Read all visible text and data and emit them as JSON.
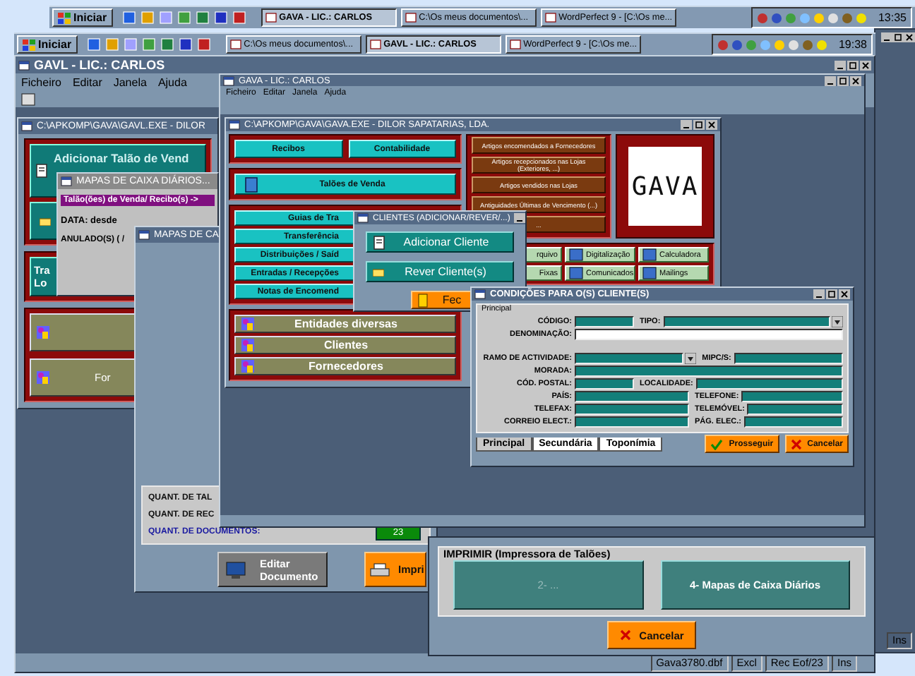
{
  "taskbars": [
    {
      "start": "Iniciar",
      "tasks": [
        {
          "label": "GAVA - LIC.: CARLOS",
          "selected": true
        },
        {
          "label": "C:\\Os meus documentos\\...",
          "selected": false
        },
        {
          "label": "WordPerfect 9 - [C:\\Os me...",
          "selected": false
        }
      ],
      "clock": "13:35"
    },
    {
      "start": "Iniciar",
      "tasks": [
        {
          "label": "C:\\Os meus documentos\\...",
          "selected": false
        },
        {
          "label": "GAVL - LIC.: CARLOS",
          "selected": true
        },
        {
          "label": "WordPerfect 9 - [C:\\Os me...",
          "selected": false
        }
      ],
      "clock": "19:38"
    }
  ],
  "back_window": {
    "status": "Ins"
  },
  "main_window": {
    "title": "GAVL - LIC.: CARLOS",
    "menu": [
      "Ficheiro",
      "Editar",
      "Janela",
      "Ajuda"
    ],
    "status_bar": [
      "Gava3780.dbf",
      "Excl",
      "Rec Eof/23",
      "Ins"
    ]
  },
  "gavl_exe_window": {
    "title": "C:\\APKOMP\\GAVA\\GAVL.EXE - DILOR",
    "add_button": "Adicionar Talão de Vend",
    "transfer_button": [
      "Tra",
      "Lo"
    ],
    "supplier_button": "For"
  },
  "daily_maps_window": {
    "title": "MAPAS DE CAIXA DIÁRIOS...",
    "range_label": "Talão(ões) de Venda/ Recibo(s) ->",
    "date_label": "DATA: desde",
    "cancelled_label": "ANULADO(S) ( /"
  },
  "maps_window": {
    "title": "MAPAS DE CA",
    "counts": [
      {
        "label": "QUANT. DE TAL",
        "highlight": false
      },
      {
        "label": "QUANT. DE REC",
        "highlight": false
      },
      {
        "label": "QUANT. DE DOCUMENTOS:",
        "highlight": true,
        "value": "23"
      }
    ],
    "edit_button": [
      "Editar",
      "Documento"
    ],
    "print_button": "Impri"
  },
  "gava_window": {
    "title": "GAVA - LIC.: CARLOS",
    "menu": [
      "Ficheiro",
      "Editar",
      "Janela",
      "Ajuda"
    ]
  },
  "gava_exe_window": {
    "title": "C:\\APKOMP\\GAVA\\GAVA.EXE - DILOR SAPATARIAS, LDA.",
    "top_buttons": [
      "Recibos",
      "Contabilidade"
    ],
    "sales_button": "Talões de Venda",
    "doc_buttons": [
      "Guias de Tra",
      "Transferência",
      "Distribuições / Saíd",
      "Entradas / Recepções",
      "Notas de Encomend"
    ],
    "entity_buttons": [
      "Entidades diversas",
      "Clientes",
      "Fornecedores"
    ],
    "report_buttons": [
      "Artigos encomendados a Fornecedores",
      "Artigos recepcionados nas Lojas (Exteriores, ...)",
      "Artigos vendidos nas Lojas",
      "Antiguidades Últimas de Vencimento (...)",
      "..."
    ],
    "logo": "GAVA",
    "tool_buttons": [
      "rquivo",
      "Digitalização",
      "Calculadora",
      "Fixas",
      "Comunicados",
      "Mailings"
    ]
  },
  "clients_dialog": {
    "title": "CLIENTES (ADICIONAR/REVER/...)",
    "buttons": [
      "Adicionar Cliente",
      "Rever Cliente(s)"
    ],
    "close_button": "Fec"
  },
  "conditions_dialog": {
    "title": "CONDIÇÕES PARA O(S) CLIENTE(S)",
    "group": "Principal",
    "rows": [
      [
        {
          "label": "CÓDIGO:",
          "kind": "short"
        },
        {
          "label": "TIPO:",
          "kind": "lookup"
        }
      ],
      [
        {
          "label": "DENOMINAÇÃO:",
          "kind": "blank"
        }
      ],
      [
        {
          "label": "RAMO DE ACTIVIDADE:",
          "kind": "lookup"
        },
        {
          "label": "MIPC/S:",
          "kind": "rest"
        }
      ],
      [
        {
          "label": "MORADA:",
          "kind": "full"
        }
      ],
      [
        {
          "label": "CÓD. POSTAL:",
          "kind": "short"
        },
        {
          "label": "LOCALIDADE:",
          "kind": "rest"
        }
      ],
      [
        {
          "label": "PAÍS:",
          "kind": "half"
        },
        {
          "label": "TELEFONE:",
          "kind": "rest"
        }
      ],
      [
        {
          "label": "TELEFAX:",
          "kind": "half"
        },
        {
          "label": "TELEMÓVEL:",
          "kind": "rest"
        }
      ],
      [
        {
          "label": "CORREIO ELECT.:",
          "kind": "half"
        },
        {
          "label": "PÁG. ELEC.:",
          "kind": "rest"
        }
      ]
    ],
    "tabs": [
      {
        "label": "Principal",
        "selected": true
      },
      {
        "label": "Secundária",
        "selected": false
      },
      {
        "label": "Toponímia",
        "selected": false
      }
    ],
    "proceed_button": "Prosseguir",
    "cancel_button": "Cancelar"
  },
  "print_dialog": {
    "group": "IMPRIMIR (Impressora de Talões)",
    "buttons": [
      {
        "label": "2- ...",
        "disabled": true
      },
      {
        "label": "4- Mapas de Caixa Diários",
        "disabled": false
      }
    ],
    "cancel_button": "Cancelar"
  }
}
